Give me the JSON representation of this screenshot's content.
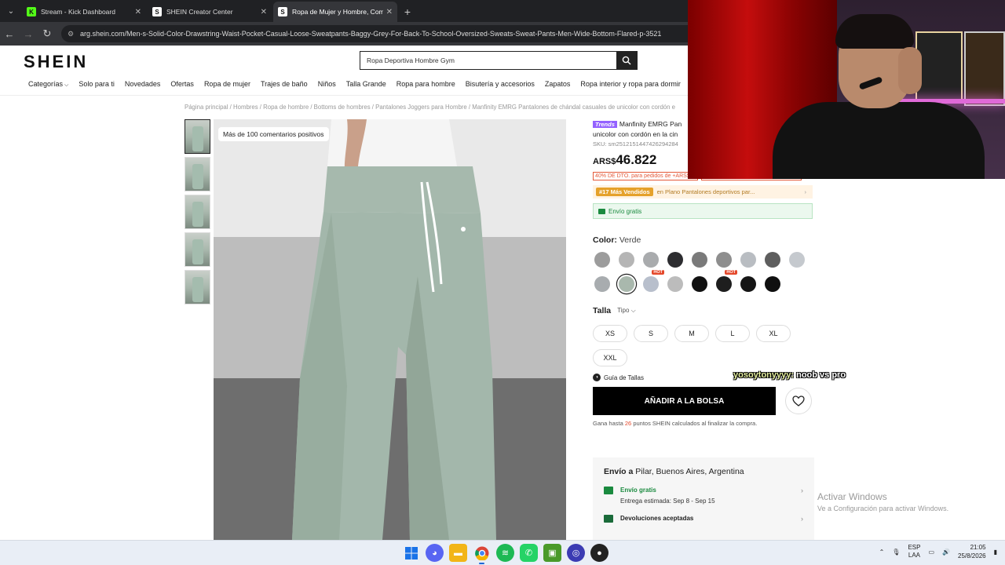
{
  "browser": {
    "tabs": [
      {
        "label": "Stream - Kick Dashboard",
        "favicon": "K",
        "favicon_color": "#53fc18"
      },
      {
        "label": "SHEIN Creator Center",
        "favicon": "S",
        "favicon_color": "#ffffff"
      },
      {
        "label": "Ropa de Mujer y Hombre, Com",
        "favicon": "S",
        "favicon_color": "#ffffff"
      }
    ],
    "url": "arg.shein.com/Men-s-Solid-Color-Drawstring-Waist-Pocket-Casual-Loose-Sweatpants-Baggy-Grey-For-Back-To-School-Oversized-Sweats-Sweat-Pants-Men-Wide-Bottom-Flared-p-3521"
  },
  "site": {
    "logo": "SHEIN",
    "search_value": "Ropa Deportiva Hombre Gym",
    "nav": [
      "Categorías",
      "Solo para ti",
      "Novedades",
      "Ofertas",
      "Ropa de mujer",
      "Trajes de baño",
      "Niños",
      "Talla Grande",
      "Ropa para hombre",
      "Bisutería y accesorios",
      "Zapatos",
      "Ropa interior y ropa para dormir"
    ],
    "breadcrumb": "Página principal / Hombres / Ropa de hombre / Bottoms de hombres / Pantalones Joggers para Hombre / Manfinity EMRG Pantalones de chándal casuales de unicolor con cordón e"
  },
  "product": {
    "image_badge": "Más de 100 comentarios positivos",
    "trends_tag": "Trends",
    "title": "Manfinity EMRG Pan unicolor con cordón en la cin",
    "sku": "SKU: sm2512151447426294284",
    "currency": "ARS$",
    "price": "46.822",
    "promos": [
      "40% DE DTO. para pedidos de +ARS$34.709",
      "47% DE DTO. Sin mínimo de"
    ],
    "bestseller_tag": "#17 Más Vendidos",
    "bestseller_text": "en Plano Pantalones deportivos par...",
    "free_shipping": "Envío gratis",
    "color_label": "Color:",
    "color_value": "Verde",
    "swatches": [
      {
        "color": "#9c9c9c",
        "hot": false,
        "selected": false
      },
      {
        "color": "#b5b5b5",
        "hot": false,
        "selected": false
      },
      {
        "color": "#a9abad",
        "hot": false,
        "selected": false
      },
      {
        "color": "#2d2d30",
        "hot": false,
        "selected": false
      },
      {
        "color": "#7a7a7a",
        "hot": false,
        "selected": false
      },
      {
        "color": "#8e8e8e",
        "hot": false,
        "selected": false
      },
      {
        "color": "#b9bdc2",
        "hot": false,
        "selected": false
      },
      {
        "color": "#5e5e5e",
        "hot": false,
        "selected": false
      },
      {
        "color": "#c5c9ce",
        "hot": false,
        "selected": false
      },
      {
        "color": "#a8acaf",
        "hot": false,
        "selected": false
      },
      {
        "color": "#a9b8ad",
        "hot": false,
        "selected": true
      },
      {
        "color": "#b8bfcc",
        "hot": true,
        "selected": false
      },
      {
        "color": "#bcbcbc",
        "hot": false,
        "selected": false
      },
      {
        "color": "#111111",
        "hot": false,
        "selected": false
      },
      {
        "color": "#1e1e1e",
        "hot": true,
        "selected": false
      },
      {
        "color": "#151515",
        "hot": false,
        "selected": false
      },
      {
        "color": "#0f0f0f",
        "hot": false,
        "selected": false
      }
    ],
    "hot_label": "HOT",
    "size_label": "Talla",
    "size_type": "Tipo",
    "sizes": [
      "XS",
      "S",
      "M",
      "L",
      "XL",
      "XXL"
    ],
    "size_guide": "Guía de Tallas",
    "add_to_bag": "AÑADIR A LA BOLSA",
    "points_prefix": "Gana hasta",
    "points_value": "26",
    "points_suffix": "puntos SHEIN calculados al finalizar la compra."
  },
  "shipping": {
    "title_prefix": "Envío a",
    "location": "Pilar, Buenos Aires, Argentina",
    "free_label": "Envío gratis",
    "estimate": "Entrega estimada: Sep 8 - Sep 15",
    "returns": "Devoluciones aceptadas"
  },
  "overlay": {
    "chat_user": "yosoytonyyyy:",
    "chat_msg": "noob vs pro",
    "activate_title": "Activar Windows",
    "activate_sub": "Ve a Configuración para activar Windows."
  },
  "taskbar": {
    "lang_1": "ESP",
    "lang_2": "LAA",
    "time": "21:05",
    "date": "25/8/2026"
  }
}
